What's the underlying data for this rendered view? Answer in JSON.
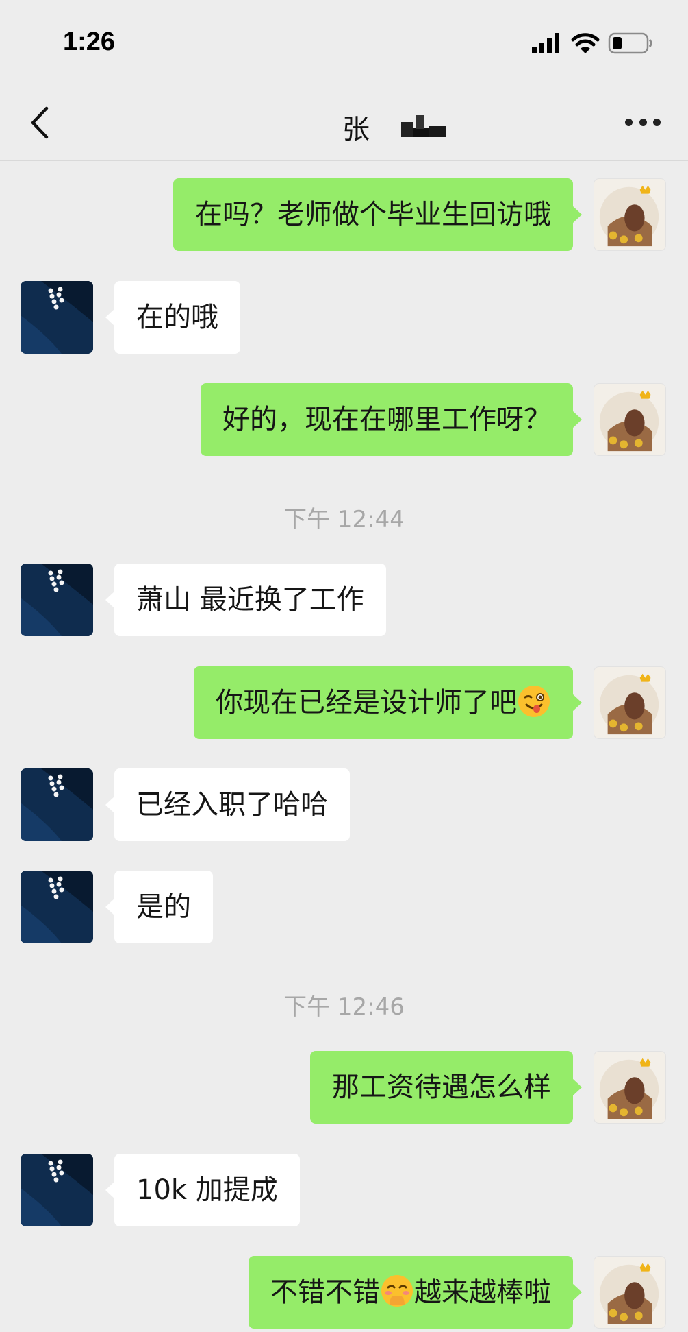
{
  "status_bar": {
    "time": "1:26"
  },
  "header": {
    "title": "张"
  },
  "messages": [
    {
      "text": "在吗？老师做个毕业生回访哦"
    },
    {
      "text": "在的哦"
    },
    {
      "text": "好的，现在在哪里工作呀？"
    },
    {
      "text": "下午 12:44"
    },
    {
      "text": "萧山 最近换了工作"
    },
    {
      "text": "你现在已经是设计师了吧"
    },
    {
      "text": "已经入职了哈哈"
    },
    {
      "text": "是的"
    },
    {
      "text": "下午 12:46"
    },
    {
      "text": "那工资待遇怎么样"
    },
    {
      "text": "10k 加提成"
    },
    {
      "text": "不错不错"
    },
    {
      "text": "越来越棒啦"
    }
  ],
  "emoji_names": [
    "winking-tongue-emoji",
    "shy-emoji"
  ],
  "colors": {
    "sent_bubble": "#95ec69",
    "received_bubble": "#ffffff",
    "background": "#ededed"
  }
}
